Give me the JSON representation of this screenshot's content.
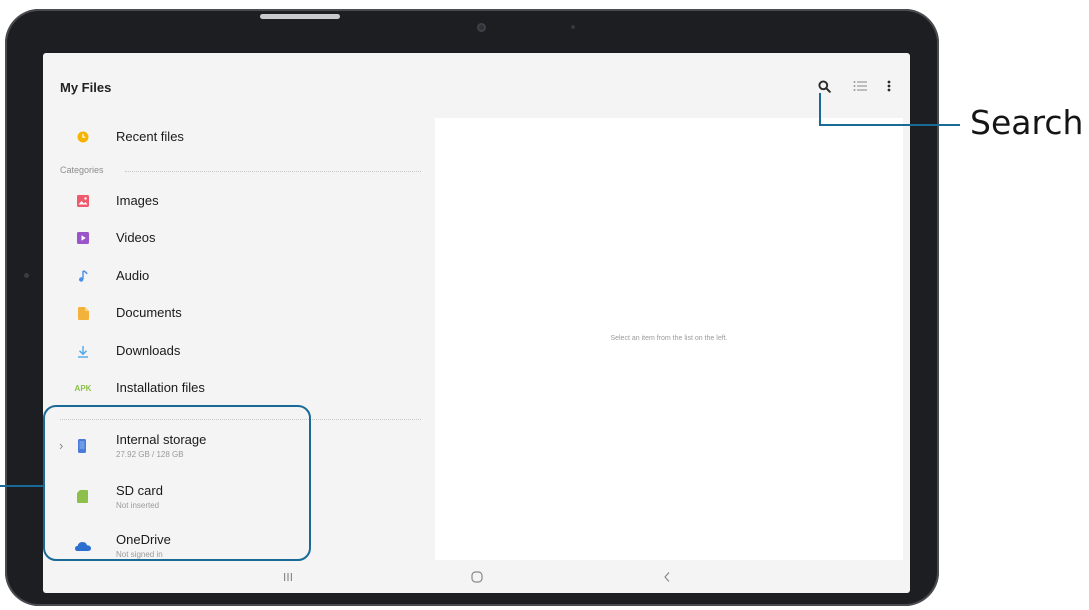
{
  "app": {
    "title": "My Files"
  },
  "toolbar": {
    "search_icon": "search-icon",
    "list_icon": "list-view-icon",
    "more_icon": "more-options-icon"
  },
  "sidebar": {
    "recent": {
      "label": "Recent files",
      "icon": "clock-icon",
      "color": "#f5b400"
    },
    "categories_label": "Categories",
    "categories": [
      {
        "label": "Images",
        "icon": "image-icon",
        "color": "#ef5a6c"
      },
      {
        "label": "Videos",
        "icon": "video-icon",
        "color": "#9a55c8"
      },
      {
        "label": "Audio",
        "icon": "music-note-icon",
        "color": "#4a8ee8"
      },
      {
        "label": "Documents",
        "icon": "document-icon",
        "color": "#f2b33d"
      },
      {
        "label": "Downloads",
        "icon": "download-icon",
        "color": "#4fa6e8"
      },
      {
        "label": "Installation files",
        "icon": "apk-icon",
        "icon_text": "APK",
        "color": "#8cc04a"
      }
    ],
    "storage": [
      {
        "label": "Internal storage",
        "detail": "27.92 GB / 128 GB",
        "icon": "phone-storage-icon",
        "color": "#4a7bd8"
      },
      {
        "label": "SD card",
        "detail": "Not inserted",
        "icon": "sd-card-icon",
        "color": "#8cc04a"
      },
      {
        "label": "OneDrive",
        "detail": "Not signed in",
        "icon": "onedrive-cloud-icon",
        "color": "#2d6fd0"
      }
    ]
  },
  "detail": {
    "message": "Select an item from the list on the left."
  },
  "navbar": {
    "recents": "recent-apps-icon",
    "home": "home-icon",
    "back": "back-icon"
  },
  "callouts": {
    "search": "Search",
    "color": "#1a6a97"
  }
}
